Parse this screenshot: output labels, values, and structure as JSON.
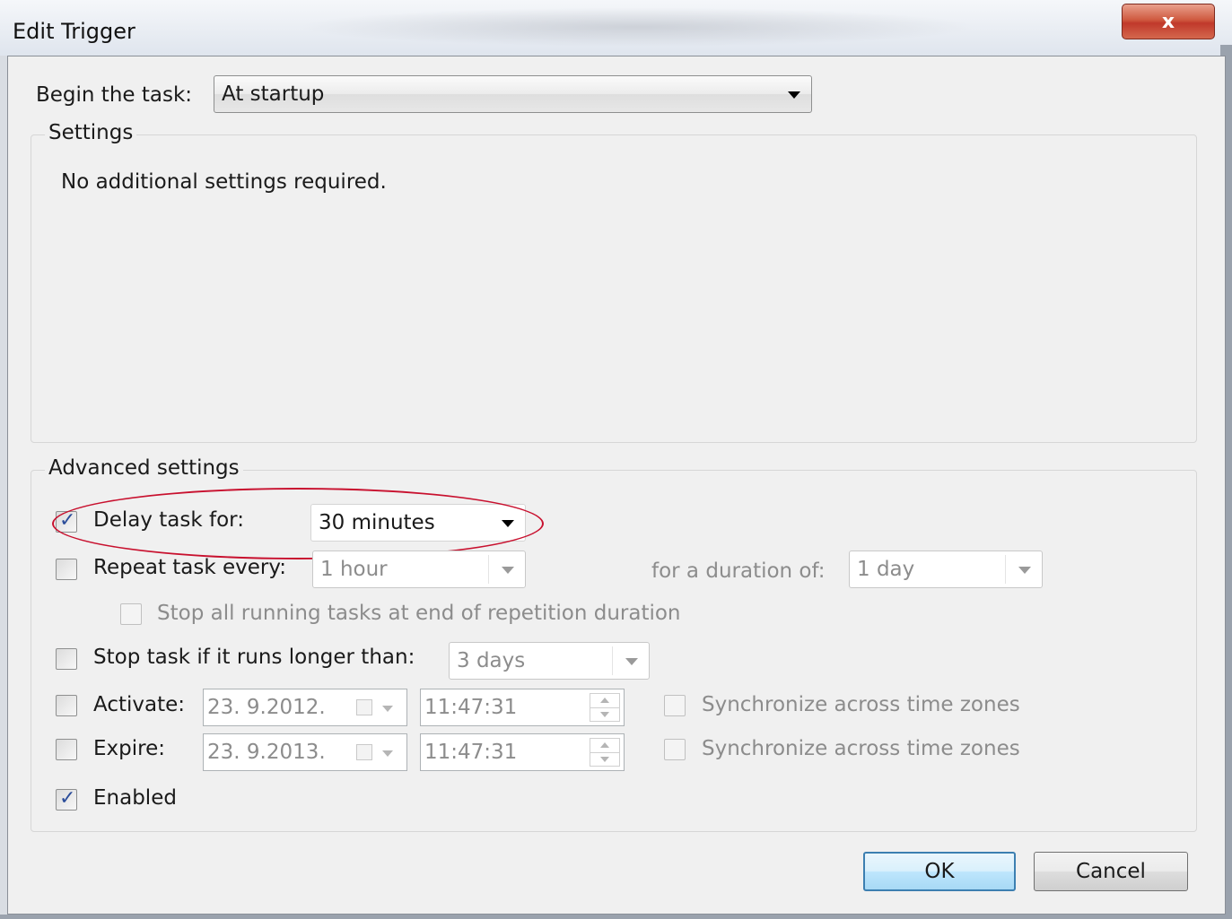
{
  "window": {
    "title": "Edit Trigger",
    "close_label": "x"
  },
  "begin_task": {
    "label": "Begin the task:",
    "value": "At startup"
  },
  "settings": {
    "title": "Settings",
    "message": "No additional settings required."
  },
  "advanced": {
    "title": "Advanced settings",
    "delay": {
      "label": "Delay task for:",
      "checked": true,
      "value": "30 minutes"
    },
    "repeat": {
      "label": "Repeat task every:",
      "checked": false,
      "value": "1 hour",
      "duration_label": "for a duration of:",
      "duration_value": "1 day"
    },
    "stop_all": {
      "label": "Stop all running tasks at end of repetition duration",
      "checked": false
    },
    "stop_longer": {
      "label": "Stop task if it runs longer than:",
      "checked": false,
      "value": "3 days"
    },
    "activate": {
      "label": "Activate:",
      "checked": false,
      "date": "23.  9.2012.",
      "time": "11:47:31",
      "sync_label": "Synchronize across time zones"
    },
    "expire": {
      "label": "Expire:",
      "checked": false,
      "date": "23.  9.2013.",
      "time": "11:47:31",
      "sync_label": "Synchronize across time zones"
    },
    "enabled": {
      "label": "Enabled",
      "checked": true
    }
  },
  "buttons": {
    "ok": "OK",
    "cancel": "Cancel"
  },
  "colors": {
    "highlight": "#c8102e",
    "check": "#2b4d9a",
    "default_button_border": "#3c7fb1"
  },
  "icons": {
    "close": "close-icon",
    "dropdown": "chevron-down-icon",
    "check": "check-icon",
    "calendar": "calendar-icon",
    "spinner": "spinner-icon"
  }
}
